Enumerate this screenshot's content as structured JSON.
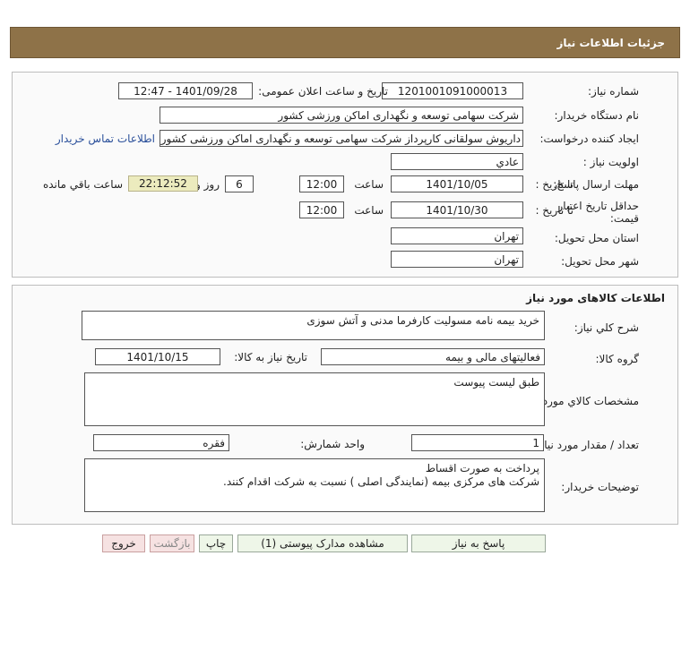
{
  "header": {
    "title": "جزئیات اطلاعات نیاز"
  },
  "info": {
    "need_number_label": "شماره نیاز:",
    "need_number": "1201001091000013",
    "announce_label": "تاریخ و ساعت اعلان عمومی:",
    "announce_value": "1401/09/28 - 12:47",
    "buyer_org_label": "نام دستگاه خریدار:",
    "buyer_org": "شرکت سهامی توسعه و نگهداری اماکن ورزشی کشور",
    "creator_label": "ایجاد کننده درخواست:",
    "creator": "داریوش سولقانی کارپرداز شرکت سهامی توسعه و نگهداری اماکن ورزشی کشور",
    "contact_link": "اطلاعات تماس خریدار",
    "priority_label": "اولویت نیاز :",
    "priority": "عادي",
    "deadline_label": "مهلت ارسال پاسخ:",
    "to_date_label": "تا تاریخ :",
    "deadline_date": "1401/10/05",
    "time_label": "ساعت",
    "deadline_time": "12:00",
    "days_value": "6",
    "days_label": "روز و",
    "remaining_time": "22:12:52",
    "remaining_label": "ساعت باقي مانده",
    "validity_label": "حداقل تاریخ اعتبار قیمت:",
    "validity_date": "1401/10/30",
    "validity_time": "12:00",
    "province_label": "استان محل تحویل:",
    "province": "تهران",
    "city_label": "شهر محل تحویل:",
    "city": "تهران"
  },
  "goods": {
    "section_title": "اطلاعات کالاهای مورد نیاز",
    "summary_label": "شرح کلي نیاز:",
    "summary": "خرید بیمه نامه مسولیت کارفرما مدنی و آتش سوزی",
    "group_label": "گروه کالا:",
    "group": "فعالیتهای مالی و بیمه",
    "need_date_label": "تاریخ نیاز به کالا:",
    "need_date": "1401/10/15",
    "specs_label": "مشخصات کالاي مورد نیاز:",
    "specs": "طبق لیست پیوست",
    "qty_label": "تعداد / مقدار مورد نیاز:",
    "qty": "1",
    "unit_label": "واحد شمارش:",
    "unit": "فقره",
    "buyer_notes_label": "توضیحات خریدار:",
    "buyer_notes_line1": "پرداخت به صورت اقساط",
    "buyer_notes_line2": "شرکت های مرکزی بیمه (نمایندگی اصلی ) نسبت به شرکت اقدام کنند."
  },
  "buttons": {
    "reply": "پاسخ به نیاز",
    "view_docs": "مشاهده مدارک پیوستی (1)",
    "print": "چاپ",
    "back": "بازگشت",
    "exit": "خروج"
  }
}
